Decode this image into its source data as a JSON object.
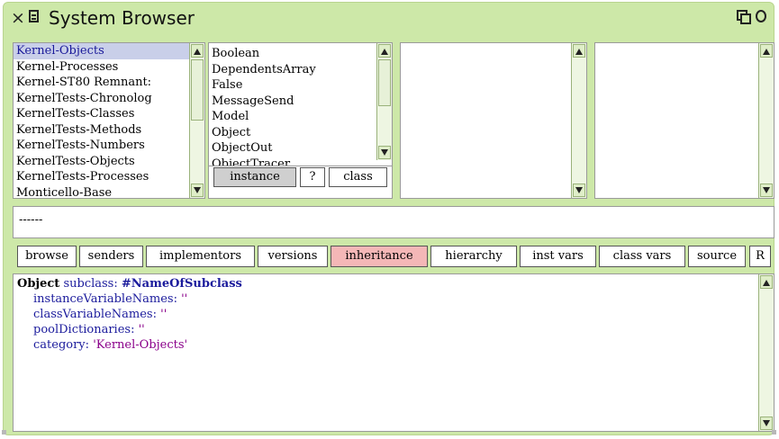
{
  "window": {
    "title": "System Browser"
  },
  "packages": {
    "items": [
      "Kernel-Objects",
      "Kernel-Processes",
      "Kernel-ST80 Remnant:",
      "KernelTests-Chronolog",
      "KernelTests-Classes",
      "KernelTests-Methods",
      "KernelTests-Numbers",
      "KernelTests-Objects",
      "KernelTests-Processes",
      "Monticello-Base"
    ],
    "selected": "Kernel-Objects"
  },
  "classes": {
    "items": [
      "Boolean",
      "DependentsArray",
      "False",
      "MessageSend",
      "Model",
      "Object",
      "ObjectOut",
      "ObjectTracer"
    ]
  },
  "class_toggle": {
    "instance": "instance",
    "help": "?",
    "class": "class"
  },
  "message_pane": {
    "text": "------"
  },
  "toolbar": {
    "browse": "browse",
    "senders": "senders",
    "implementors": "implementors",
    "versions": "versions",
    "inheritance": "inheritance",
    "hierarchy": "hierarchy",
    "inst_vars": "inst vars",
    "class_vars": "class vars",
    "source": "source",
    "r": "R"
  },
  "code": {
    "l1_kw": "Object",
    "l1_sel": "subclass:",
    "l1_sym": "#NameOfSubclass",
    "l2_sel": "instanceVariableNames:",
    "l2_str": "''",
    "l3_sel": "classVariableNames:",
    "l3_str": "''",
    "l4_sel": "poolDictionaries:",
    "l4_str": "''",
    "l5_sel": "category:",
    "l5_str": "'Kernel-Objects'"
  },
  "colors": {
    "window_bg": "#cde8a8",
    "selection": "#c9cfe9",
    "active_button": "#f4b7b7",
    "selector": "#1b1b9c",
    "string": "#8a008a"
  }
}
